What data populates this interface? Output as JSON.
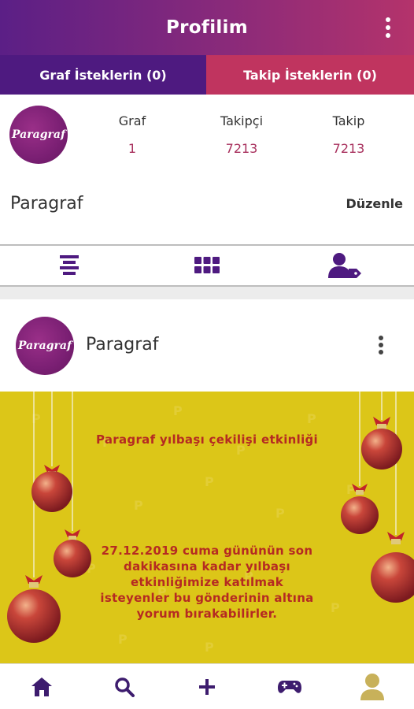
{
  "header": {
    "title": "Profilim",
    "menu_icon": "kebab-menu-icon"
  },
  "request_tabs": [
    {
      "label": "Graf İsteklerin (0)"
    },
    {
      "label": "Takip İsteklerin (0)"
    }
  ],
  "profile": {
    "avatar_text": "Paragraf",
    "stats": [
      {
        "label": "Graf",
        "value": "1"
      },
      {
        "label": "Takipçi",
        "value": "7213"
      },
      {
        "label": "Takip",
        "value": "7213"
      }
    ],
    "name": "Paragraf",
    "edit_label": "Düzenle"
  },
  "view_tabs": [
    {
      "icon": "list-icon"
    },
    {
      "icon": "grid-icon"
    },
    {
      "icon": "user-tag-icon"
    }
  ],
  "post": {
    "avatar_text": "Paragraf",
    "author": "Paragraf",
    "banner_title": "Paragraf yılbaşı çekilişi etkinliği",
    "banner_lines": [
      "27.12.2019 cuma gününün son",
      "dakikasına kadar yılbaşı",
      "etkinliğimize katılmak",
      "isteyenler bu gönderinin altına",
      "yorum bırakabilirler."
    ]
  },
  "bottom_nav": [
    {
      "icon": "home-icon"
    },
    {
      "icon": "search-icon"
    },
    {
      "icon": "plus-icon"
    },
    {
      "icon": "gamepad-icon"
    },
    {
      "icon": "profile-icon"
    }
  ],
  "colors": {
    "header_start": "#5b1f86",
    "header_end": "#b4336b",
    "tab_left": "#4e1a80",
    "tab_right": "#c0345f",
    "stat_value": "#a8305d",
    "icon_purple": "#4e1a80",
    "banner_bg": "#dcc618",
    "banner_text": "#b52a22",
    "nav_icon": "#3d1c6e",
    "nav_active": "#c8b15a"
  }
}
